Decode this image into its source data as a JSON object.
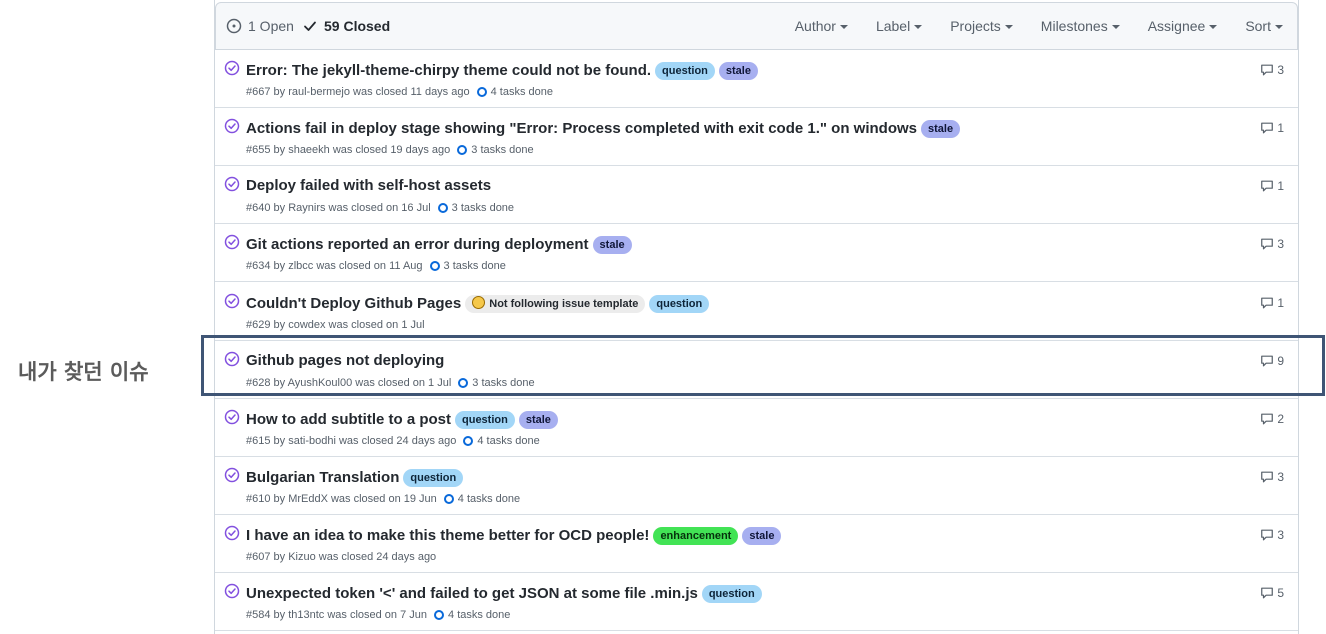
{
  "header": {
    "open_label": "1 Open",
    "closed_label": "59 Closed",
    "filters": [
      "Author",
      "Label",
      "Projects",
      "Milestones",
      "Assignee",
      "Sort"
    ]
  },
  "annotation": {
    "text": "내가 찾던 이슈",
    "highlight_color": "#3f5575"
  },
  "colors": {
    "closed_icon": "#8250df",
    "task_ring": "#0969da",
    "label_question": "#a2d6f7",
    "label_stale": "#a7aff0",
    "label_enhancement": "#42e355"
  },
  "issues": [
    {
      "title": "Error: The jekyll-theme-chirpy theme could not be found.",
      "labels": [
        "question",
        "stale"
      ],
      "meta": "#667 by raul-bermejo was closed 11 days ago",
      "tasks": "4 tasks done",
      "comments": "3"
    },
    {
      "title": "Actions fail in deploy stage showing \"Error: Process completed with exit code 1.\" on windows",
      "labels": [
        "stale"
      ],
      "meta": "#655 by shaeekh was closed 19 days ago",
      "tasks": "3 tasks done",
      "comments": "1"
    },
    {
      "title": "Deploy failed with self-host assets",
      "labels": [],
      "meta": "#640 by Raynirs was closed on 16 Jul",
      "tasks": "3 tasks done",
      "comments": "1"
    },
    {
      "title": "Git actions reported an error during deployment",
      "labels": [
        "stale"
      ],
      "meta": "#634 by zlbcc was closed on 11 Aug",
      "tasks": "3 tasks done",
      "comments": "3"
    },
    {
      "title": "Couldn't Deploy Github Pages",
      "labels": [
        "Not following issue template",
        "question"
      ],
      "meta": "#629 by cowdex was closed on 1 Jul",
      "tasks": "",
      "comments": "1"
    },
    {
      "title": "Github pages not deploying",
      "labels": [],
      "meta": "#628 by AyushKoul00 was closed on 1 Jul",
      "tasks": "3 tasks done",
      "comments": "9"
    },
    {
      "title": "How to add subtitle to a post",
      "labels": [
        "question",
        "stale"
      ],
      "meta": "#615 by sati-bodhi was closed 24 days ago",
      "tasks": "4 tasks done",
      "comments": "2"
    },
    {
      "title": "Bulgarian Translation",
      "labels": [
        "question"
      ],
      "meta": "#610 by MrEddX was closed on 19 Jun",
      "tasks": "4 tasks done",
      "comments": "3"
    },
    {
      "title": "I have an idea to make this theme better for OCD people!",
      "labels": [
        "enhancement",
        "stale"
      ],
      "meta": "#607 by Kizuo was closed 24 days ago",
      "tasks": "",
      "comments": "3"
    },
    {
      "title": "Unexpected token '<' and failed to get JSON at some file .min.js",
      "labels": [
        "question"
      ],
      "meta": "#584 by th13ntc was closed on 7 Jun",
      "tasks": "4 tasks done",
      "comments": "5"
    }
  ]
}
